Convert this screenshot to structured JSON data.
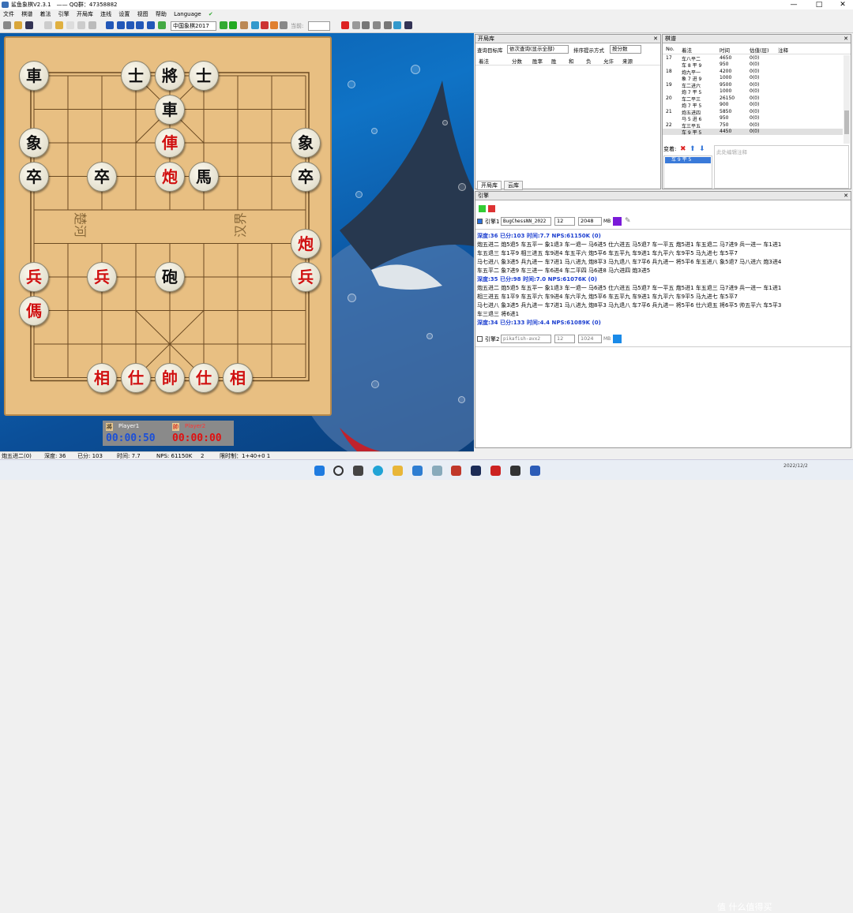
{
  "title": "鲨鱼象棋V2.3.1　—— QQ群：47358882",
  "window_buttons": [
    "—",
    "□",
    "✕"
  ],
  "menu": [
    "文件",
    "棋谱",
    "着法",
    "引擎",
    "开局库",
    "连线",
    "设置",
    "视图",
    "帮助",
    "Language"
  ],
  "toolbar": {
    "library": "中国象棋2017",
    "opening": "当前:"
  },
  "board": {
    "river_left": "楚河",
    "river_right": "汉界",
    "pieces": [
      {
        "c": "車",
        "s": "b",
        "col": 0,
        "row": 0
      },
      {
        "c": "士",
        "s": "b",
        "col": 3,
        "row": 0
      },
      {
        "c": "將",
        "s": "b",
        "col": 4,
        "row": 0
      },
      {
        "c": "士",
        "s": "b",
        "col": 5,
        "row": 0
      },
      {
        "c": "車",
        "s": "b",
        "col": 4,
        "row": 1
      },
      {
        "c": "象",
        "s": "b",
        "col": 0,
        "row": 2
      },
      {
        "c": "俥",
        "s": "r",
        "col": 4,
        "row": 2
      },
      {
        "c": "象",
        "s": "b",
        "col": 8,
        "row": 2
      },
      {
        "c": "卒",
        "s": "b",
        "col": 0,
        "row": 3
      },
      {
        "c": "卒",
        "s": "b",
        "col": 2,
        "row": 3
      },
      {
        "c": "炮",
        "s": "r",
        "col": 4,
        "row": 3
      },
      {
        "c": "馬",
        "s": "b",
        "col": 5,
        "row": 3
      },
      {
        "c": "卒",
        "s": "b",
        "col": 8,
        "row": 3
      },
      {
        "c": "炮",
        "s": "r",
        "col": 8,
        "row": 5
      },
      {
        "c": "兵",
        "s": "r",
        "col": 0,
        "row": 6
      },
      {
        "c": "兵",
        "s": "r",
        "col": 2,
        "row": 6
      },
      {
        "c": "砲",
        "s": "b",
        "col": 4,
        "row": 6
      },
      {
        "c": "兵",
        "s": "r",
        "col": 8,
        "row": 6
      },
      {
        "c": "傌",
        "s": "r",
        "col": 0,
        "row": 7
      },
      {
        "c": "相",
        "s": "r",
        "col": 2,
        "row": 9
      },
      {
        "c": "仕",
        "s": "r",
        "col": 3,
        "row": 9
      },
      {
        "c": "帥",
        "s": "r",
        "col": 4,
        "row": 9
      },
      {
        "c": "仕",
        "s": "r",
        "col": 5,
        "row": 9
      },
      {
        "c": "相",
        "s": "r",
        "col": 6,
        "row": 9
      }
    ]
  },
  "players": {
    "p1_badge": "將",
    "p1": "Player1",
    "p1_time": "00:00:50",
    "p2_badge": "帥",
    "p2": "Player2",
    "p2_time": "00:00:00"
  },
  "status": [
    "炮五进二(0)",
    "深度: 36",
    "已分: 103",
    "时间: 7.7",
    "NPS: 61150K",
    "2",
    "限时制：1+40+0 1"
  ],
  "opening": {
    "title": "开局库",
    "query_label": "查询目标库",
    "query_value": "依次查询(显示全部)",
    "sort_label": "排序提示方式",
    "sort_value": "按分数",
    "columns": [
      "着法",
      "分数",
      "胜率",
      "胜",
      "和",
      "负",
      "允许",
      "来源"
    ],
    "tabs": [
      "开局库",
      "云库"
    ]
  },
  "record": {
    "title": "棋谱",
    "columns": [
      "No.",
      "着法",
      "时间",
      "估值(层)",
      "注释"
    ],
    "rows": [
      {
        "no": "17",
        "m1": "车八平二",
        "t1": "4650",
        "v1": "0(0)",
        "m2": "车 8 平 9",
        "t2": "950",
        "v2": "0(0)"
      },
      {
        "no": "18",
        "m1": "炮九平一",
        "t1": "4200",
        "v1": "0(0)",
        "m2": "象 7 进 9",
        "t2": "1000",
        "v2": "0(0)"
      },
      {
        "no": "19",
        "m1": "车二进六",
        "t1": "9500",
        "v1": "0(0)",
        "m2": "炮 7 平 5",
        "t2": "1000",
        "v2": "0(0)"
      },
      {
        "no": "20",
        "m1": "车二平三",
        "t1": "26150",
        "v1": "0(0)",
        "m2": "炮 7 平 5",
        "t2": "900",
        "v2": "0(0)"
      },
      {
        "no": "21",
        "m1": "炮五进四",
        "t1": "5850",
        "v1": "0(0)",
        "m2": "马 5 进 6",
        "t2": "950",
        "v2": "0(0)"
      },
      {
        "no": "22",
        "m1": "车三平五",
        "t1": "750",
        "v1": "0(0)",
        "m2": "车 9 平 5",
        "t2": "4450",
        "v2": "0(0)"
      }
    ],
    "variation_label": "变着:",
    "variation_item": "车 9 平 5",
    "comment_placeholder": "此处编辑注释"
  },
  "engine": {
    "title": "引擎",
    "e1_label": "引擎1",
    "e1_name": "BugChessNN_2022",
    "e1_threads": "12",
    "e1_hash": "2048",
    "e1_unit": "MB",
    "e2_label": "引擎2",
    "e2_name": "pikafish-avx2",
    "e2_threads": "12",
    "e2_hash": "1024",
    "e2_unit": "MB",
    "output": [
      {
        "h": true,
        "t": "深度:36  已分:103  时间:7.7  NPS:61150K  (0)"
      },
      {
        "h": false,
        "t": "炮五进二 炮5退5 车五平一 象1退3 车一退一 马6进5 仕六进五 马5退7 车一平五 炮5进1 车五退二 马7进9 兵一进一 车1进1"
      },
      {
        "h": false,
        "t": "车五退三 车1平9 相三进五 车9进4 车五平六 炮5平6 车五平九 车9进1 车九平六 车9平5 马九进七 车5平7"
      },
      {
        "h": false,
        "t": "马七进八 象3进5 兵九进一 车7进1 马八进九 炮8平3 马九退八 车7平6 兵九进一 将5平6 车五进八 象5退7 马八进六 炮3进4"
      },
      {
        "h": false,
        "t": "车五平二 象7进9 车三进一 车6进4 车二平四 马6进8 马六进四 炮3进5"
      },
      {
        "h": true,
        "t": "深度:35  已分:98  时间:7.0  NPS:61076K  (0)"
      },
      {
        "h": false,
        "t": "炮五进二 炮5退5 车五平一 象1退3 车一退一 马6进5 仕六进五 马5退7 车一平五 炮5进1 车五退三 马7进9 兵一进一 车1进1"
      },
      {
        "h": false,
        "t": "相三进五 车1平9 车五平六 车9进4 车六平九 炮5平6 车五平九 车9进1 车九平六 车9平5 马九进七 车5平7"
      },
      {
        "h": false,
        "t": "马七进八 象3进5 兵九进一 车7进1 马八进九 炮8平3 马九退八 车7平6 兵九进一 将5平6 仕六退五 将6平5 帅五平六 车5平3"
      },
      {
        "h": false,
        "t": "车三退三 将6进1"
      },
      {
        "h": true,
        "t": "深度:34  已分:133  时间:4.4  NPS:61089K  (0)"
      }
    ]
  },
  "tray": {
    "date": "2022/12/2",
    "brand": "值 什么值得买"
  }
}
